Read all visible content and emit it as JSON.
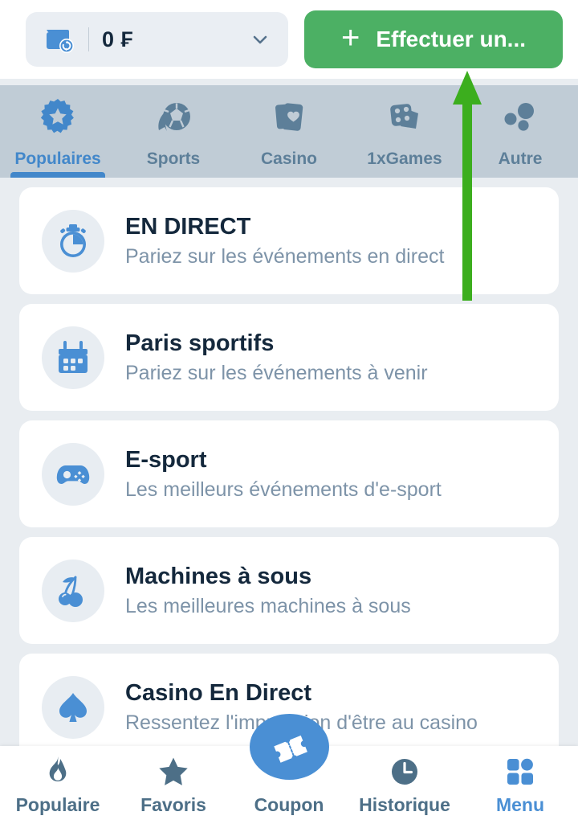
{
  "topbar": {
    "wallet_icon": "wallet-refresh-icon",
    "balance": "0 ₣",
    "dropdown_icon": "chevron-down-icon",
    "cta_plus": "+",
    "cta_label": "Effectuer un...",
    "cta_color": "#4cb064"
  },
  "tabs": {
    "active_index": 0,
    "bg_color": "#c0ccd6",
    "active_color": "#4287ca",
    "inactive_color": "#5d7f99",
    "items": [
      {
        "label": "Populaires",
        "icon": "star-burst-icon"
      },
      {
        "label": "Sports",
        "icon": "soccer-ball-icon"
      },
      {
        "label": "Casino",
        "icon": "playing-cards-heart-icon"
      },
      {
        "label": "1xGames",
        "icon": "dice-card-icon"
      },
      {
        "label": "Autre",
        "icon": "three-dots-icon"
      }
    ]
  },
  "list": {
    "items": [
      {
        "title": "EN DIRECT",
        "subtitle": "Pariez sur les événements en direct",
        "icon": "stopwatch-icon"
      },
      {
        "title": "Paris sportifs",
        "subtitle": "Pariez sur les événements à venir",
        "icon": "calendar-icon"
      },
      {
        "title": "E-sport",
        "subtitle": "Les meilleurs événements d'e-sport",
        "icon": "gamepad-icon"
      },
      {
        "title": "Machines à sous",
        "subtitle": "Les meilleures machines à sous",
        "icon": "cherries-icon"
      },
      {
        "title": "Casino En Direct",
        "subtitle": "Ressentez l'impression d'être au casino",
        "icon": "spade-icon"
      }
    ],
    "icon_color": "#4a8fd4",
    "icon_bg_color": "#e8edf2",
    "title_color": "#14283c",
    "subtitle_color": "#7d93a8"
  },
  "bottomnav": {
    "active_index": 4,
    "active_color": "#4a8fd4",
    "inactive_color": "#4d6f87",
    "items": [
      {
        "label": "Populaire",
        "icon": "flame-icon"
      },
      {
        "label": "Favoris",
        "icon": "star-icon"
      },
      {
        "label": "Coupon",
        "icon": "ticket-icon"
      },
      {
        "label": "Historique",
        "icon": "clock-icon"
      },
      {
        "label": "Menu",
        "icon": "grid-menu-icon"
      }
    ]
  },
  "annotation": {
    "arrow_color": "#3cae1e",
    "arrow_direction": "up"
  }
}
